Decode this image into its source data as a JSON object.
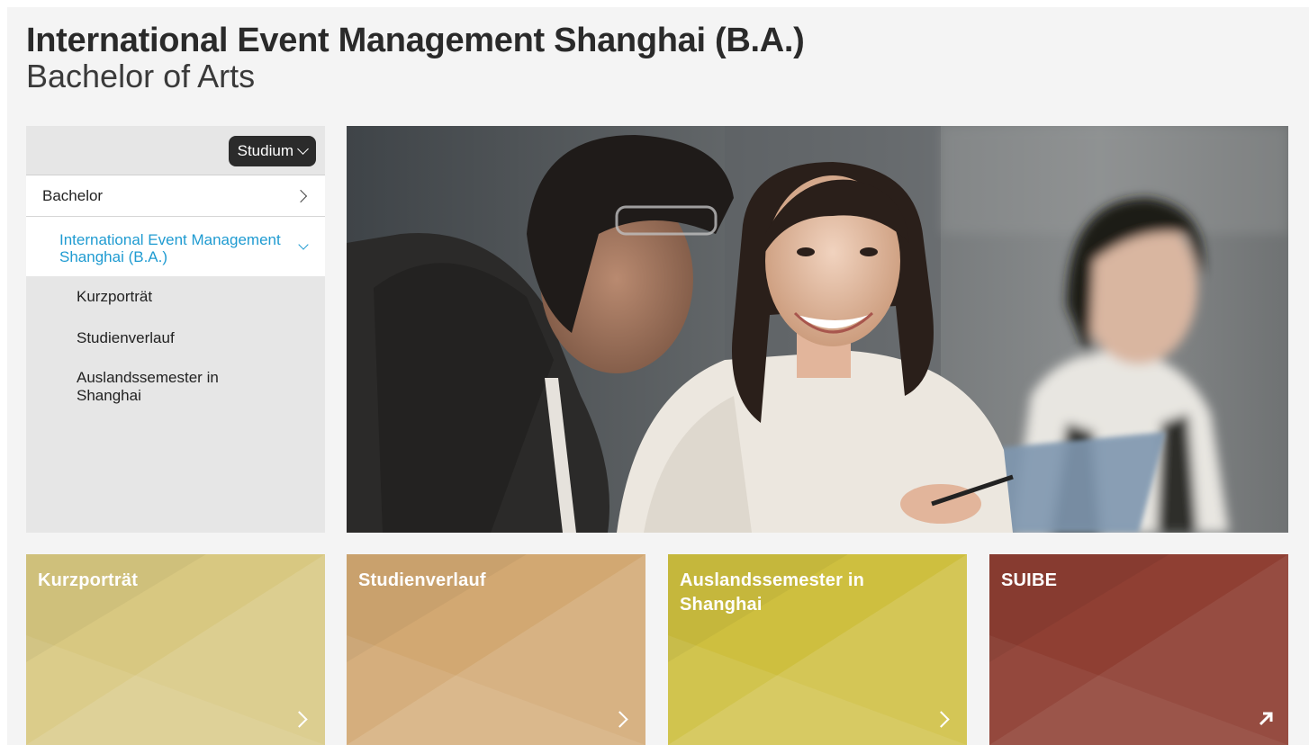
{
  "header": {
    "title": "International Event Management Shanghai (B.A.)",
    "subtitle": "Bachelor of Arts"
  },
  "sidebar": {
    "dropdown_label": "Studium",
    "parent_item": "Bachelor",
    "current_item": "International Event Management Shanghai (B.A.)",
    "sub_items": [
      {
        "label": "Kurzporträt"
      },
      {
        "label": "Studienverlauf"
      },
      {
        "label": "Auslandssemester in Shanghai"
      }
    ]
  },
  "hero": {
    "icon": "photo-students"
  },
  "tiles": [
    {
      "label": "Kurzporträt",
      "color": "#d8c881",
      "icon": "chevron-right-icon"
    },
    {
      "label": "Studienverlauf",
      "color": "#d2a872",
      "icon": "chevron-right-icon"
    },
    {
      "label": "Auslandssemester in Shanghai",
      "color": "#cebf3f",
      "icon": "chevron-right-icon"
    },
    {
      "label": "SUIBE",
      "color": "#8f3f33",
      "icon": "external-link-icon"
    }
  ],
  "colors": {
    "accent": "#1f9bd1",
    "dropdown_bg": "#2b2b2b",
    "page_bg": "#f4f4f4",
    "sidebar_bg": "#e6e6e6"
  }
}
